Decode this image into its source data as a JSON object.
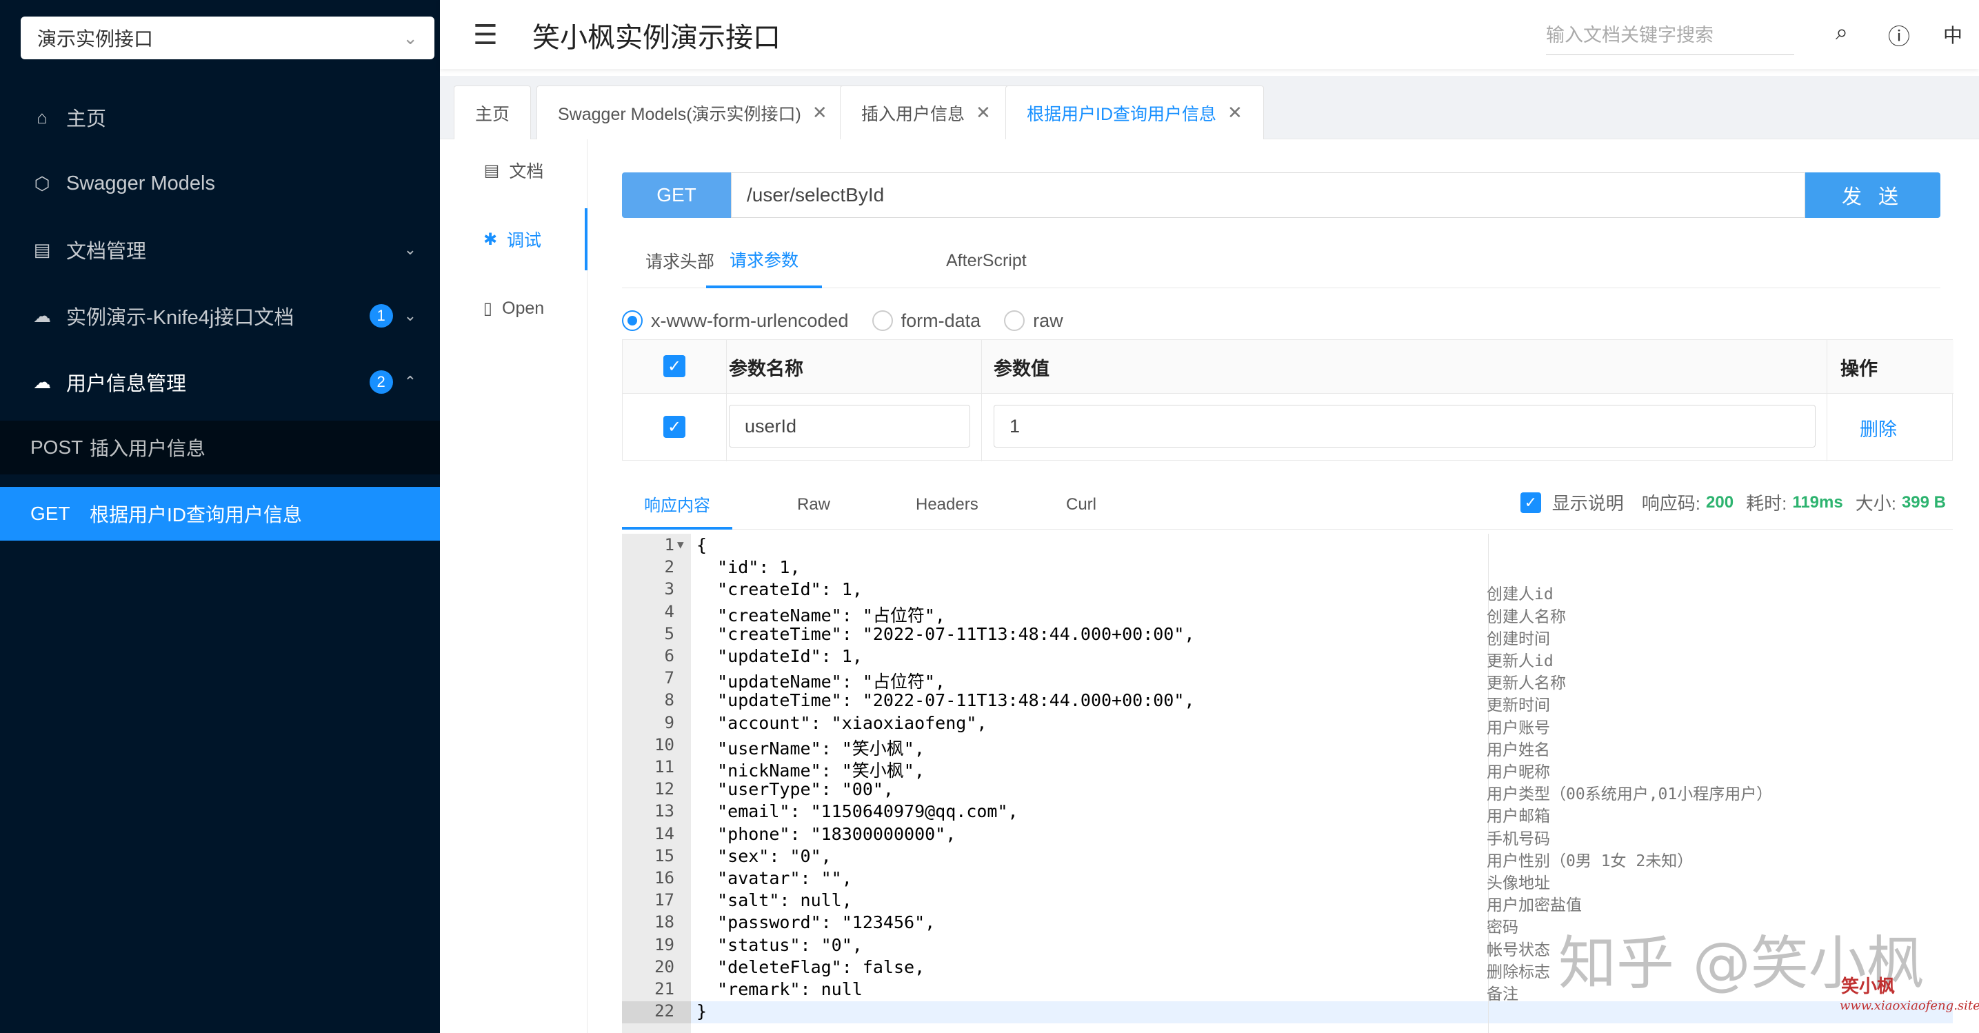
{
  "sidebar": {
    "group_select": "演示实例接口",
    "items": [
      {
        "label": "主页",
        "icon": "home-icon"
      },
      {
        "label": "Swagger Models",
        "icon": "cube-icon"
      },
      {
        "label": "文档管理",
        "icon": "doc-manage-icon"
      },
      {
        "label": "实例演示-Knife4j接口文档",
        "icon": "cloud-icon",
        "badge": "1"
      },
      {
        "label": "用户信息管理",
        "icon": "cloud-icon",
        "badge": "2"
      }
    ],
    "sub_items": [
      {
        "method": "POST",
        "label": "插入用户信息"
      },
      {
        "method": "GET",
        "label": "根据用户ID查询用户信息"
      }
    ]
  },
  "header": {
    "title": "笑小枫实例演示接口",
    "search_placeholder": "输入文档关键字搜索",
    "lang": "中"
  },
  "tabs": [
    {
      "label": "主页"
    },
    {
      "label": "Swagger Models(演示实例接口)"
    },
    {
      "label": "插入用户信息"
    },
    {
      "label": "根据用户ID查询用户信息"
    }
  ],
  "mini_menu": [
    {
      "label": "文档"
    },
    {
      "label": "调试"
    },
    {
      "label": "Open"
    }
  ],
  "request": {
    "method": "GET",
    "url": "/user/selectById",
    "send_label": "发 送",
    "tabs": [
      "请求头部",
      "请求参数",
      "AfterScript"
    ],
    "body_types": [
      "x-www-form-urlencoded",
      "form-data",
      "raw"
    ],
    "table_headers": {
      "name": "参数名称",
      "value": "参数值",
      "ops": "操作"
    },
    "params": [
      {
        "name": "userId",
        "value": "1",
        "action": "删除"
      }
    ]
  },
  "response": {
    "tabs": [
      "响应内容",
      "Raw",
      "Headers",
      "Curl"
    ],
    "show_desc_label": "显示说明",
    "code_label": "响应码:",
    "code": "200",
    "time_label": "耗时:",
    "time": "119ms",
    "size_label": "大小:",
    "size": "399 B",
    "lines": [
      {
        "no": "1",
        "code": "{",
        "comment": ""
      },
      {
        "no": "2",
        "code": "  \"id\": 1,",
        "comment": ""
      },
      {
        "no": "3",
        "code": "  \"createId\": 1,",
        "comment": "创建人id"
      },
      {
        "no": "4",
        "code": "  \"createName\": \"占位符\",",
        "comment": "创建人名称"
      },
      {
        "no": "5",
        "code": "  \"createTime\": \"2022-07-11T13:48:44.000+00:00\",",
        "comment": "创建时间"
      },
      {
        "no": "6",
        "code": "  \"updateId\": 1,",
        "comment": "更新人id"
      },
      {
        "no": "7",
        "code": "  \"updateName\": \"占位符\",",
        "comment": "更新人名称"
      },
      {
        "no": "8",
        "code": "  \"updateTime\": \"2022-07-11T13:48:44.000+00:00\",",
        "comment": "更新时间"
      },
      {
        "no": "9",
        "code": "  \"account\": \"xiaoxiaofeng\",",
        "comment": "用户账号"
      },
      {
        "no": "10",
        "code": "  \"userName\": \"笑小枫\",",
        "comment": "用户姓名"
      },
      {
        "no": "11",
        "code": "  \"nickName\": \"笑小枫\",",
        "comment": "用户昵称"
      },
      {
        "no": "12",
        "code": "  \"userType\": \"00\",",
        "comment": "用户类型（00系统用户,01小程序用户）"
      },
      {
        "no": "13",
        "code": "  \"email\": \"1150640979@qq.com\",",
        "comment": "用户邮箱"
      },
      {
        "no": "14",
        "code": "  \"phone\": \"18300000000\",",
        "comment": "手机号码"
      },
      {
        "no": "15",
        "code": "  \"sex\": \"0\",",
        "comment": "用户性别（0男 1女 2未知）"
      },
      {
        "no": "16",
        "code": "  \"avatar\": \"\",",
        "comment": "头像地址"
      },
      {
        "no": "17",
        "code": "  \"salt\": null,",
        "comment": "用户加密盐值"
      },
      {
        "no": "18",
        "code": "  \"password\": \"123456\",",
        "comment": "密码"
      },
      {
        "no": "19",
        "code": "  \"status\": \"0\",",
        "comment": "帐号状态"
      },
      {
        "no": "20",
        "code": "  \"deleteFlag\": false,",
        "comment": "删除标志"
      },
      {
        "no": "21",
        "code": "  \"remark\": null",
        "comment": "备注"
      },
      {
        "no": "22",
        "code": "}",
        "comment": ""
      }
    ]
  },
  "watermark": {
    "text": "知乎 @笑小枫",
    "logo": "笑小枫",
    "url": "www.xiaoxiaofeng.site"
  }
}
